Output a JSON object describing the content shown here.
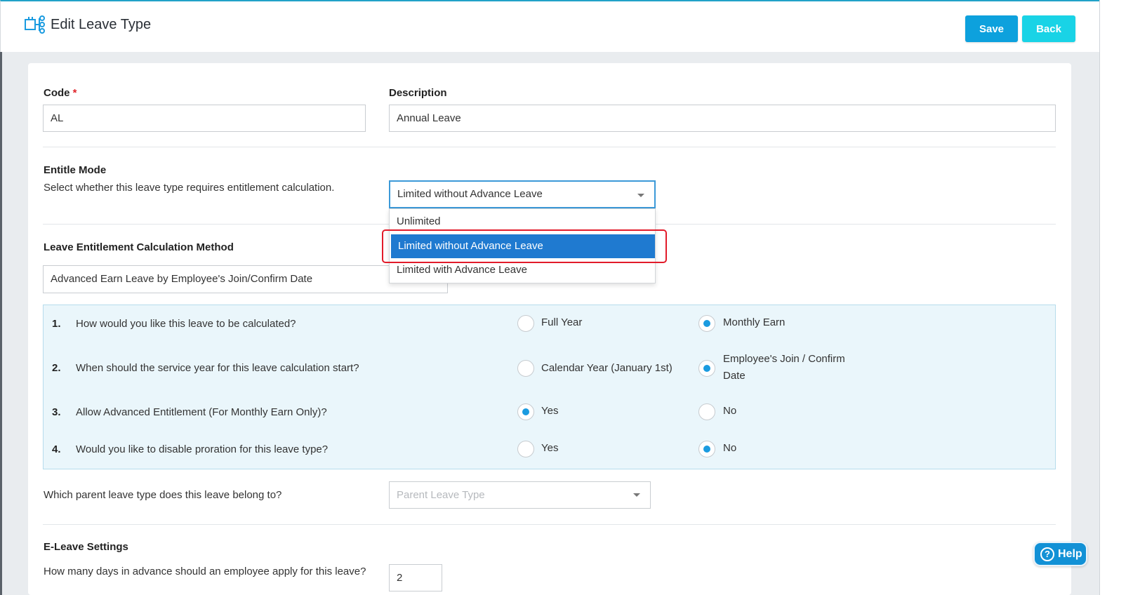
{
  "header": {
    "title": "Edit Leave Type",
    "save_label": "Save",
    "back_label": "Back"
  },
  "form": {
    "code": {
      "label": "Code",
      "required_mark": "*",
      "value": "AL"
    },
    "description": {
      "label": "Description",
      "value": "Annual Leave"
    },
    "entitle_mode": {
      "label": "Entitle Mode",
      "hint": "Select whether this leave type requires entitlement calculation.",
      "selected": "Limited without Advance Leave",
      "options": [
        "Unlimited",
        "Limited without Advance Leave",
        "Limited with Advance Leave"
      ]
    },
    "calc_method": {
      "label": "Leave Entitlement Calculation Method",
      "value": "Advanced Earn Leave by Employee's Join/Confirm Date"
    },
    "questions": [
      {
        "num": "1.",
        "text": "How would you like this leave to be calculated?",
        "opt_a": "Full Year",
        "opt_b": "Monthly Earn",
        "selected": "b"
      },
      {
        "num": "2.",
        "text": "When should the service year for this leave calculation start?",
        "opt_a": "Calendar Year (January 1st)",
        "opt_b_line1": "Employee's Join / Confirm",
        "opt_b_line2": "Date",
        "selected": "b"
      },
      {
        "num": "3.",
        "text": "Allow Advanced Entitlement (For Monthly Earn Only)?",
        "opt_a": "Yes",
        "opt_b": "No",
        "selected": "a"
      },
      {
        "num": "4.",
        "text": "Would you like to disable proration for this leave type?",
        "opt_a": "Yes",
        "opt_b": "No",
        "selected": "b"
      }
    ],
    "parent": {
      "question": "Which parent leave type does this leave belong to?",
      "placeholder": "Parent Leave Type"
    },
    "eleave": {
      "label": "E-Leave Settings",
      "advance_question": "How many days in advance should an employee apply for this leave?",
      "advance_value": "2"
    }
  },
  "help": {
    "label": "Help",
    "icon_glyph": "?"
  },
  "colors": {
    "accent": "#0da1dd",
    "back_button": "#19d3e6",
    "selected_option": "#1f7ad0",
    "highlight_border": "#e21b2a",
    "radio_checked": "#1a9be0"
  }
}
